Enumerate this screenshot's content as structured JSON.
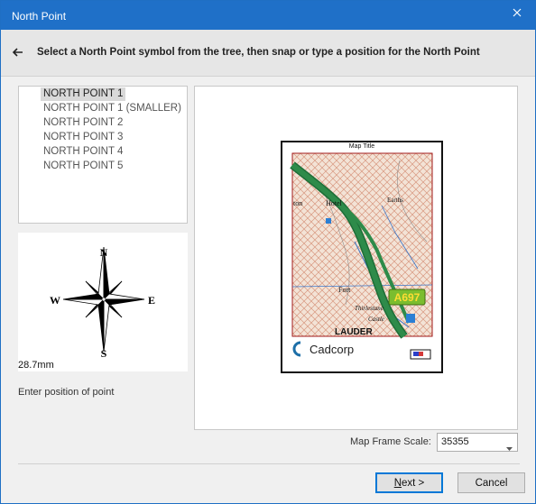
{
  "window": {
    "title": "North Point"
  },
  "header": {
    "instruction": "Select a North Point symbol from the tree, then snap or type a position for the North Point"
  },
  "tree": {
    "items": [
      {
        "label": "NORTH POINT 1",
        "selected": true
      },
      {
        "label": "NORTH POINT 1 (SMALLER)",
        "selected": false
      },
      {
        "label": "NORTH POINT 2",
        "selected": false
      },
      {
        "label": "NORTH POINT 3",
        "selected": false
      },
      {
        "label": "NORTH POINT 4",
        "selected": false
      },
      {
        "label": "NORTH POINT 5",
        "selected": false
      }
    ]
  },
  "preview": {
    "compass_labels": {
      "n": "N",
      "s": "S",
      "e": "E",
      "w": "W"
    },
    "size": "28.7mm"
  },
  "enter_position_label": "Enter position of point",
  "map": {
    "title": "Map Title",
    "road_label": "A697",
    "place_labels": {
      "town": "LAUDER",
      "hotel": "Hotel",
      "fort": "Fort",
      "castle": "Castle",
      "earths": "Earths",
      "thirlestane": "Thirlestane",
      "ton": "ton"
    },
    "logo_text": "Cadcorp",
    "colors": {
      "road": "#2e8b4a",
      "road_sign": "#7bbd2f",
      "road_text": "#ffdd33",
      "hatch": "#d89880",
      "frame": "#a11818"
    }
  },
  "scale": {
    "label": "Map Frame Scale:",
    "value": "35355"
  },
  "buttons": {
    "next": "Next >",
    "cancel": "Cancel"
  }
}
